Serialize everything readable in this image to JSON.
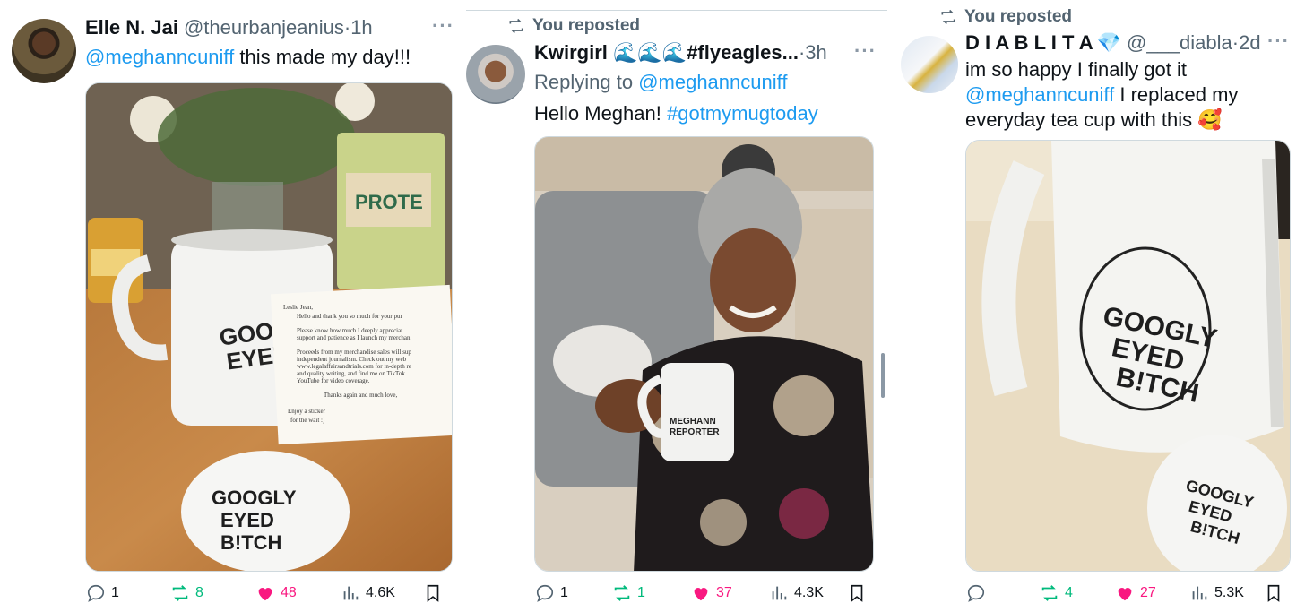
{
  "colors": {
    "link": "#1d9bf0",
    "retweet": "#00ba7c",
    "like": "#f91880",
    "muted": "#536471"
  },
  "posts": [
    {
      "author": "Elle N. Jai",
      "handle": "@theurbanjeanius",
      "dot": "·",
      "time": "1h",
      "more": "···",
      "text_link": "@meghanncuniff",
      "text_rest": " this made my day!!!",
      "media_desc_icon": "photo-icon",
      "stats": {
        "replies": "1",
        "reposts": "8",
        "likes": "48",
        "views": "4.6K"
      }
    },
    {
      "repost_label": "You reposted",
      "author": "Kwirgirl 🌊🌊🌊#flyeagles...",
      "dot": "·",
      "time": "3h",
      "more": "···",
      "reply_prefix": "Replying to ",
      "reply_to": "@meghanncuniff",
      "text_plain": "Hello Meghan! ",
      "text_hashtag": "#gotmymugtoday",
      "stats": {
        "replies": "1",
        "reposts": "1",
        "likes": "37",
        "views": "4.3K"
      }
    },
    {
      "repost_label": "You reposted",
      "author": "D I A B L I T A",
      "author_emoji": "💎",
      "handle": "@___diabla",
      "dot": "·",
      "time": "2d",
      "more": "···",
      "text_line1": "im so happy I finally got it",
      "text_link": "@meghanncuniff",
      "text_rest": " I replaced my",
      "text_line3": "everyday tea cup with this 🥰",
      "stats": {
        "replies": "",
        "reposts": "4",
        "likes": "27",
        "views": "5.3K"
      }
    }
  ]
}
